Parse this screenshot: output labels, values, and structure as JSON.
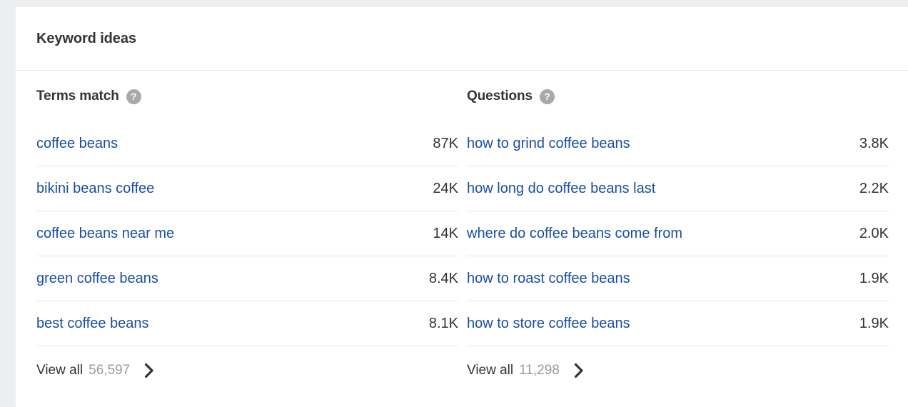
{
  "card": {
    "title": "Keyword ideas"
  },
  "columns": [
    {
      "header": "Terms match",
      "help_icon": "help-circle-icon",
      "help_glyph": "?",
      "rows": [
        {
          "keyword": "coffee beans",
          "volume": "87K"
        },
        {
          "keyword": "bikini beans coffee",
          "volume": "24K"
        },
        {
          "keyword": "coffee beans near me",
          "volume": "14K"
        },
        {
          "keyword": "green coffee beans",
          "volume": "8.4K"
        },
        {
          "keyword": "best coffee beans",
          "volume": "8.1K"
        }
      ],
      "view_all_label": "View all",
      "view_all_count": "56,597",
      "chevron_icon": "chevron-right-icon"
    },
    {
      "header": "Questions",
      "help_icon": "help-circle-icon",
      "help_glyph": "?",
      "rows": [
        {
          "keyword": "how to grind coffee beans",
          "volume": "3.8K"
        },
        {
          "keyword": "how long do coffee beans last",
          "volume": "2.2K"
        },
        {
          "keyword": "where do coffee beans come from",
          "volume": "2.0K"
        },
        {
          "keyword": "how to roast coffee beans",
          "volume": "1.9K"
        },
        {
          "keyword": "how to store coffee beans",
          "volume": "1.9K"
        }
      ],
      "view_all_label": "View all",
      "view_all_count": "11,298",
      "chevron_icon": "chevron-right-icon"
    }
  ],
  "colors": {
    "page_background": "#eceef0",
    "card_background": "#ffffff",
    "link": "#1a4ea0",
    "text": "#333333",
    "muted_text": "#989a9c",
    "divider": "#e5e7e9",
    "help_icon_bg": "#a9a9a9"
  }
}
